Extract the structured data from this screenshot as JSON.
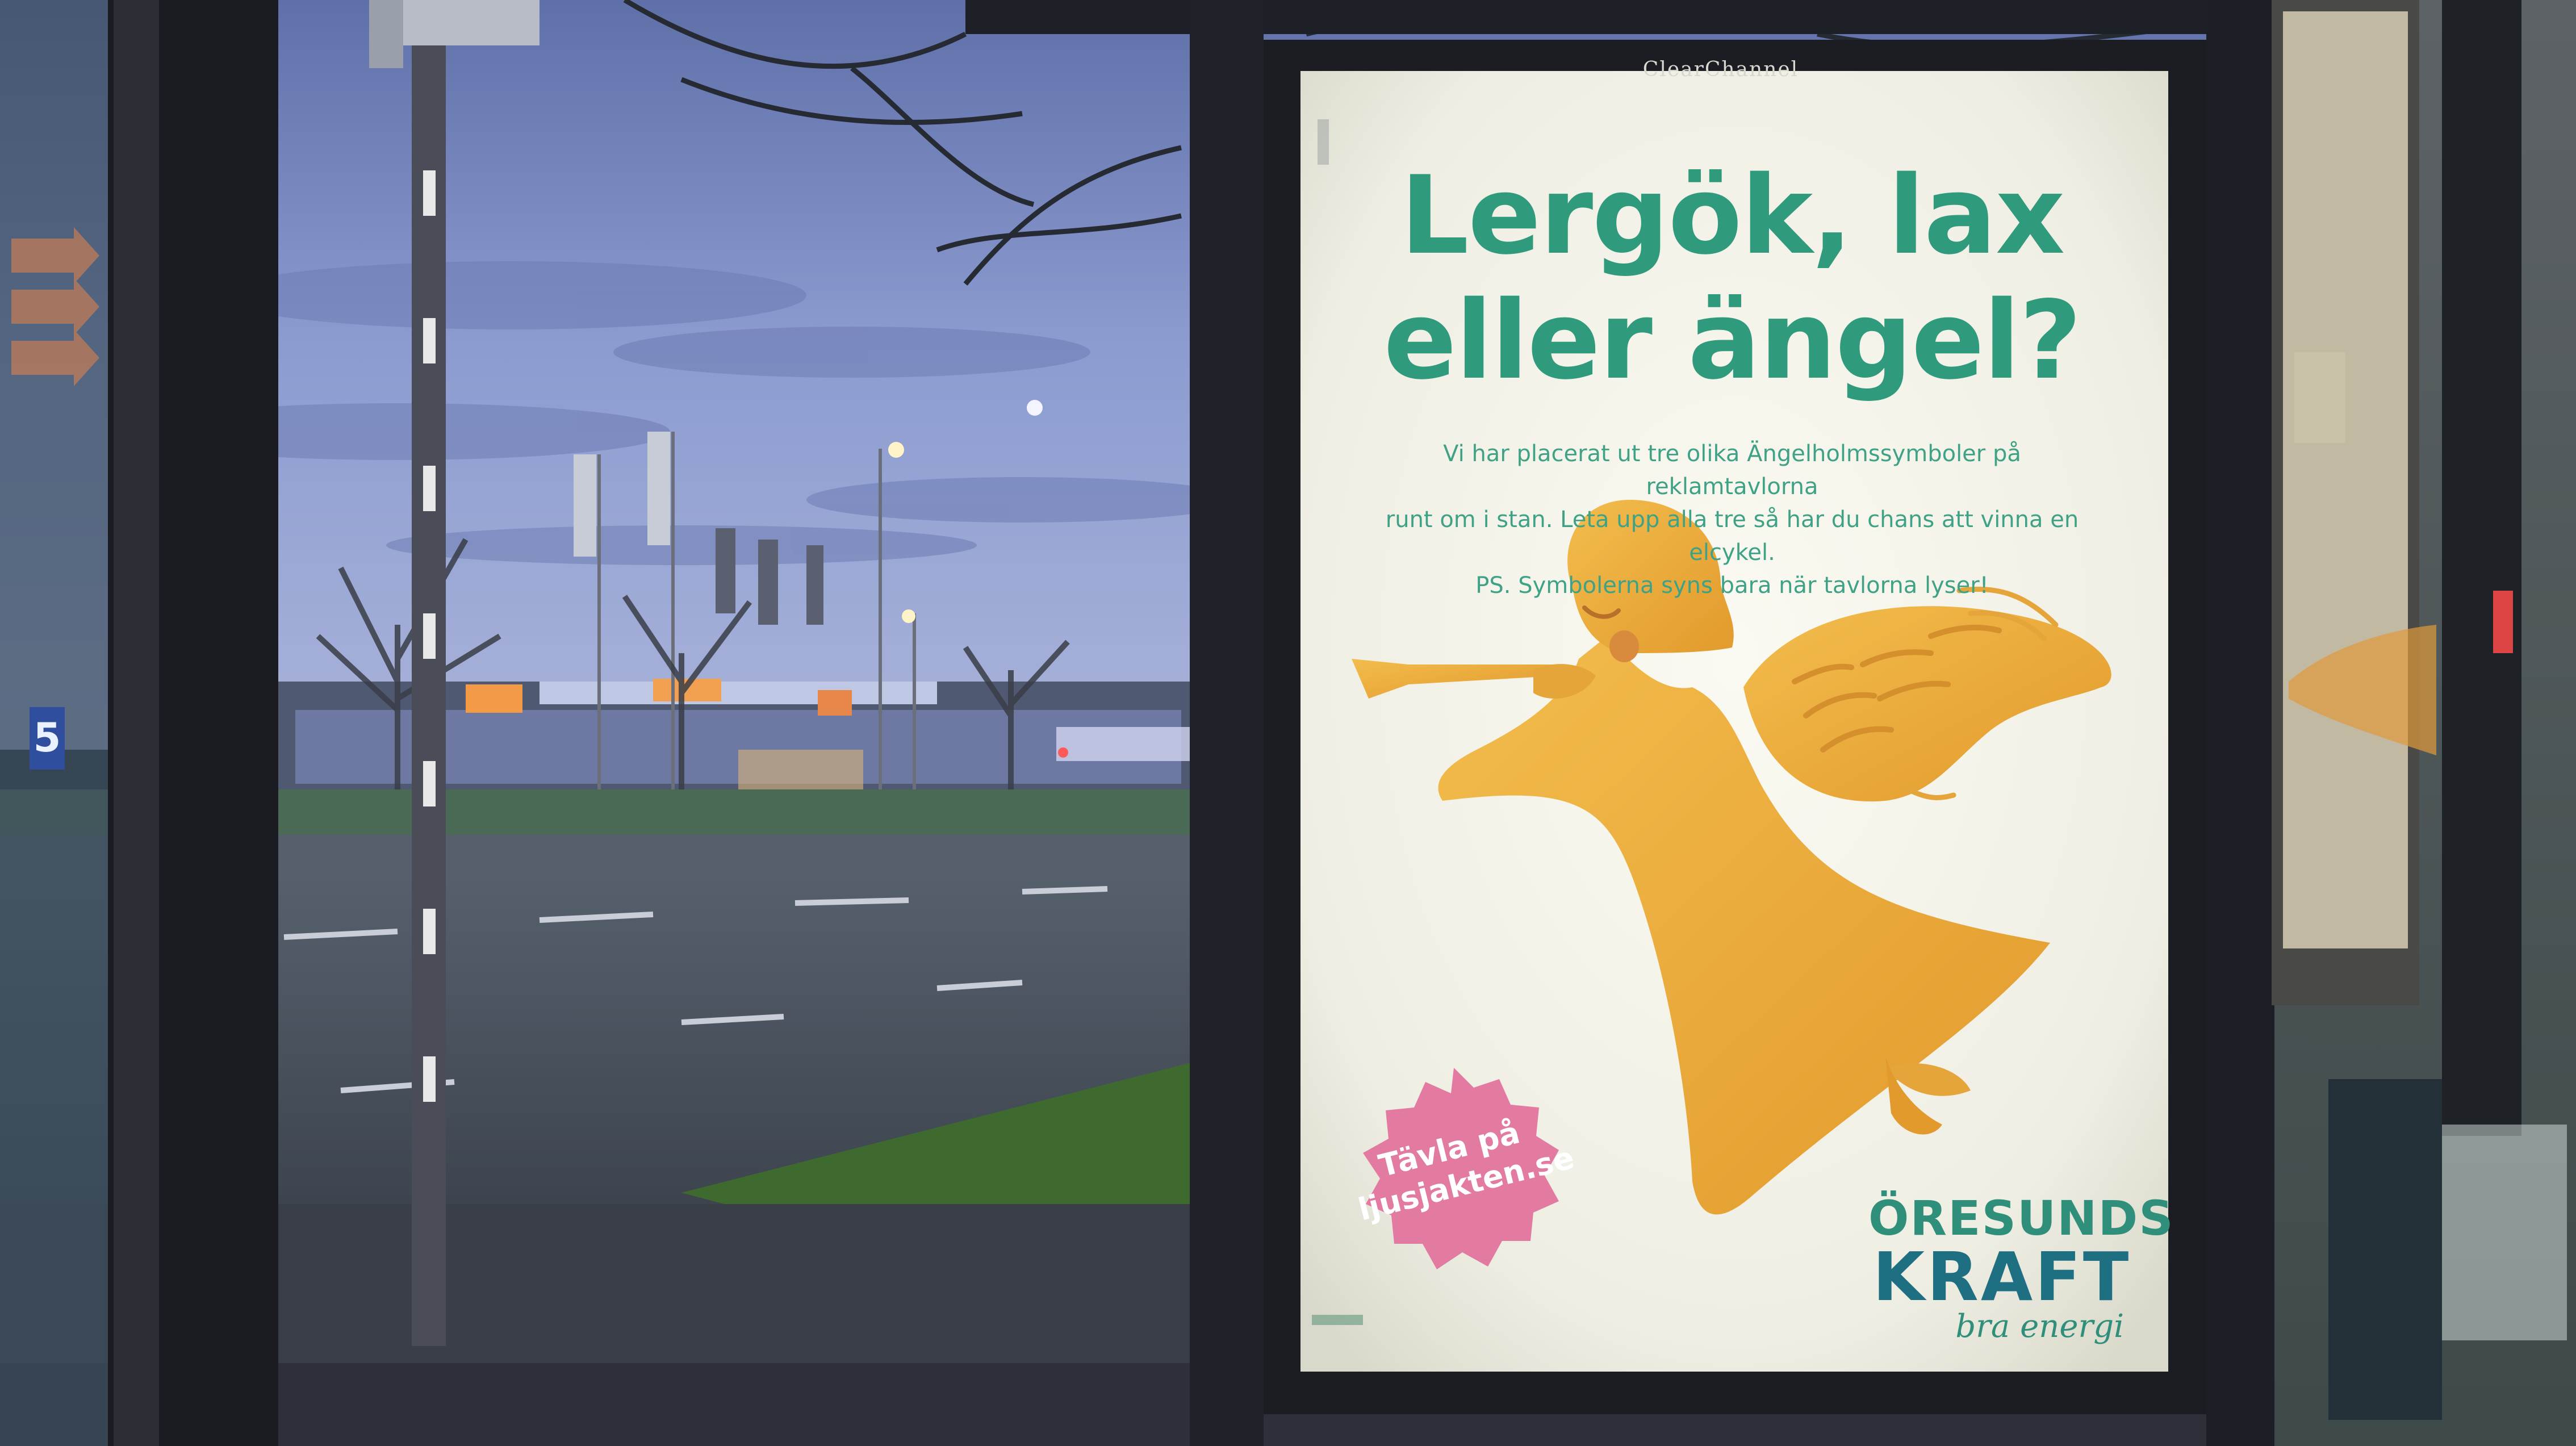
{
  "scene": "bus stop advertising poster at dusk",
  "frame_brand": "ClearChannel",
  "poster": {
    "headline_line1": "Lergök, lax",
    "headline_line2": "eller ängel?",
    "body_line1": "Vi har placerat ut tre olika Ängelholmssymboler på reklamtavlorna",
    "body_line2": "runt om i stan. Leta upp alla tre så har du chans att vinna en elcykel.",
    "body_line3": "PS. Symbolerna syns bara när tavlorna lyser!",
    "badge_line1": "Tävla på",
    "badge_line2": "ljusjakten.se",
    "brand_line1": "ÖRESUNDS",
    "brand_line2": "KRAFT",
    "brand_tagline": "bra energi"
  },
  "background": {
    "bus_sign_number": "5"
  },
  "colors": {
    "headline_green": "#2f9a7c",
    "angel_gold": "#e8a93a",
    "badge_pink": "#e27aa2",
    "poster_bg": "#f7f6ee",
    "sky_blue": "#7e8fc4"
  }
}
